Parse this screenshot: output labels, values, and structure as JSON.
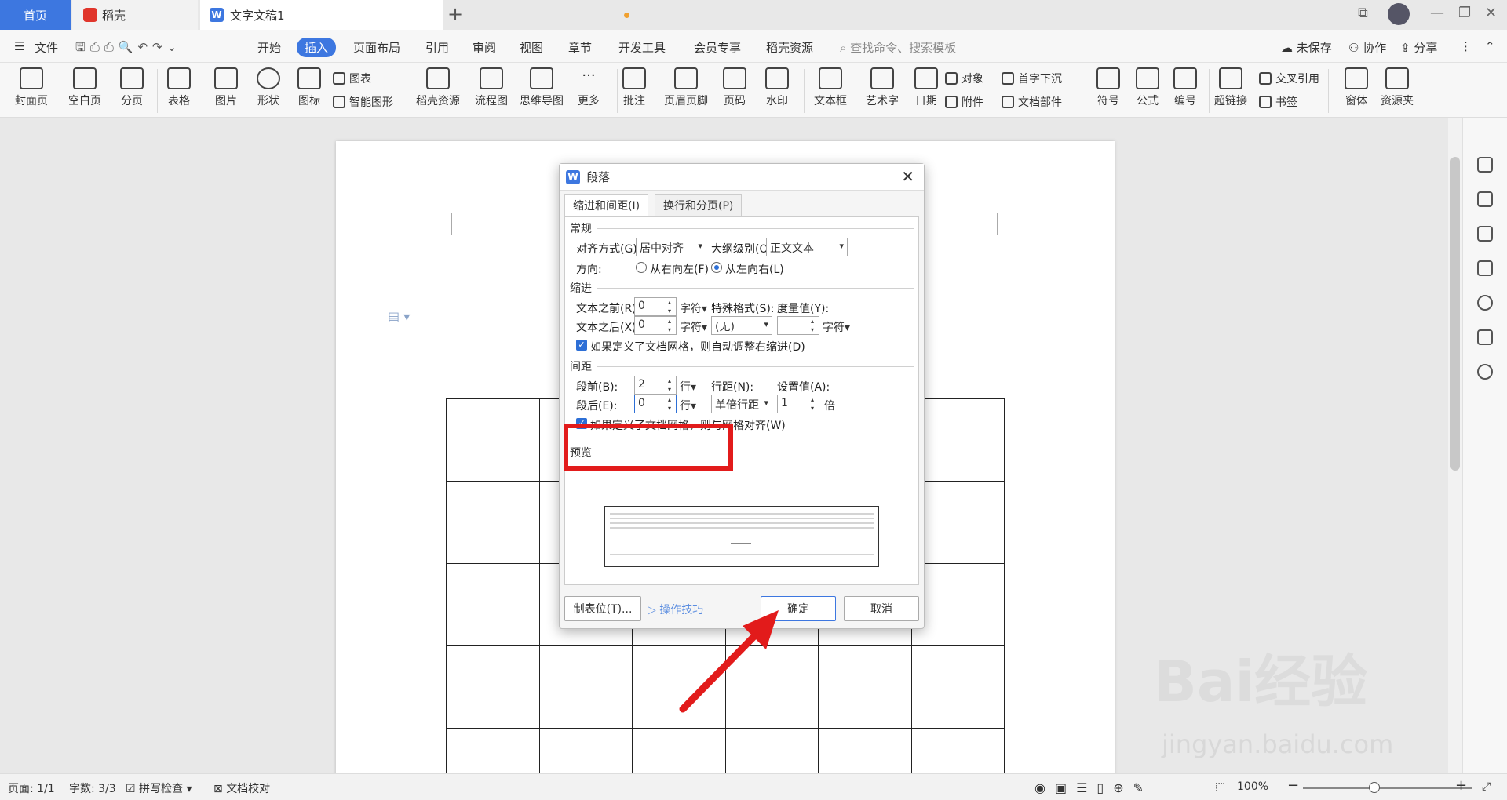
{
  "tabs": {
    "home": "首页",
    "daoke": "稻壳",
    "doc": "文字文稿1",
    "add": "+"
  },
  "menu": {
    "file": "文件",
    "items": [
      "开始",
      "插入",
      "页面布局",
      "引用",
      "审阅",
      "视图",
      "章节",
      "开发工具",
      "会员专享",
      "稻壳资源"
    ],
    "search": "查找命令、搜索模板",
    "unsaved": "未保存",
    "collab": "协作",
    "share": "分享"
  },
  "ribbon": {
    "big": [
      "封面页",
      "空白页",
      "分页",
      "表格",
      "图片",
      "形状",
      "图标",
      "稻壳资源",
      "流程图",
      "思维导图",
      "更多",
      "批注",
      "页眉页脚",
      "页码",
      "水印",
      "文本框",
      "艺术字",
      "日期",
      "符号",
      "公式",
      "编号",
      "超链接",
      "窗体",
      "资源夹"
    ],
    "small": {
      "chart": "图表",
      "smart": "智能图形",
      "object": "对象",
      "dropcap": "首字下沉",
      "attach": "附件",
      "docpart": "文档部件",
      "crossref": "交叉引用",
      "bookmark": "书签"
    }
  },
  "dialog": {
    "title": "段落",
    "tab1": "缩进和间距(I)",
    "tab2": "换行和分页(P)",
    "general": "常规",
    "align_label": "对齐方式(G):",
    "align_value": "居中对齐",
    "outline_label": "大纲级别(O):",
    "outline_value": "正文文本",
    "dir_label": "方向:",
    "rtl": "从右向左(F)",
    "ltr": "从左向右(L)",
    "indent": "缩进",
    "before_text_label": "文本之前(R):",
    "before_text_value": "0",
    "after_text_label": "文本之后(X):",
    "after_text_value": "0",
    "unit_char": "字符",
    "special_label": "特殊格式(S):",
    "special_value": "(无)",
    "measure_label": "度量值(Y):",
    "measure_value": "",
    "grid_indent": "如果定义了文档网格，则自动调整右缩进(D)",
    "spacing": "间距",
    "before_label": "段前(B):",
    "before_value": "2",
    "after_label": "段后(E):",
    "after_value": "0",
    "unit_line": "行",
    "line_spacing_label": "行距(N):",
    "line_spacing_value": "单倍行距",
    "setting_label": "设置值(A):",
    "setting_value": "1",
    "unit_times": "倍",
    "grid_align": "如果定义了文档网格，则与网格对齐(W)",
    "preview": "预览",
    "tabs_btn": "制表位(T)...",
    "tips": "操作技巧",
    "ok": "确定",
    "cancel": "取消"
  },
  "status": {
    "page": "页面: 1/1",
    "words": "字数: 3/3",
    "spell": "拼写检查",
    "proof": "文档校对",
    "zoom": "100%"
  },
  "watermark": {
    "brand": "Bai经验",
    "url": "jingyan.baidu.com"
  },
  "colors": {
    "accent": "#3d77e0",
    "highlight": "#e21b1b"
  }
}
